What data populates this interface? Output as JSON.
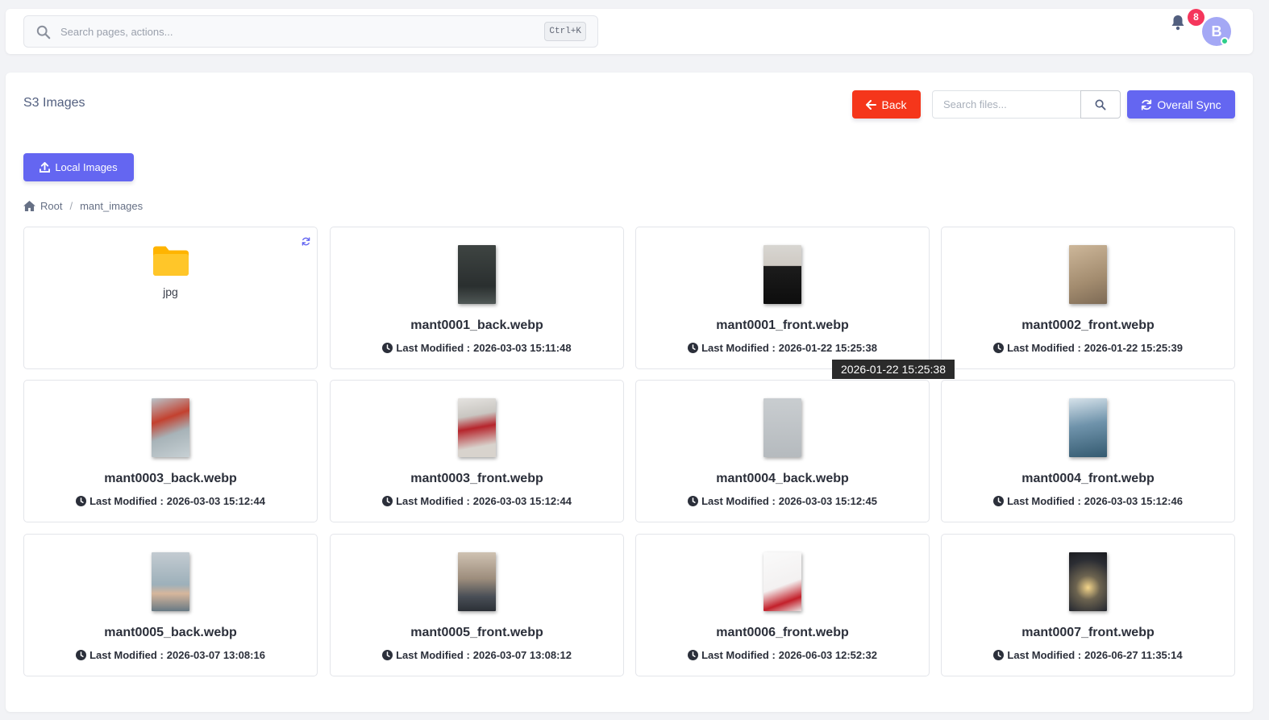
{
  "topbar": {
    "search_placeholder": "Search pages, actions...",
    "shortcut": "Ctrl+K",
    "notification_count": "8",
    "avatar_initial": "B"
  },
  "page": {
    "title": "S3 Images",
    "back_label": "Back",
    "search_files_placeholder": "Search files...",
    "sync_label": "Overall Sync",
    "local_images_label": "Local Images"
  },
  "breadcrumb": {
    "root": "Root",
    "separator": "/",
    "current": "mant_images"
  },
  "folder": {
    "name": "jpg"
  },
  "modified_prefix": "Last Modified : ",
  "files": [
    {
      "name": "mant0001_back.webp",
      "modified": "2026-03-03 15:11:48"
    },
    {
      "name": "mant0001_front.webp",
      "modified": "2026-01-22 15:25:38"
    },
    {
      "name": "mant0002_front.webp",
      "modified": "2026-01-22 15:25:39"
    },
    {
      "name": "mant0003_back.webp",
      "modified": "2026-03-03 15:12:44"
    },
    {
      "name": "mant0003_front.webp",
      "modified": "2026-03-03 15:12:44"
    },
    {
      "name": "mant0004_back.webp",
      "modified": "2026-03-03 15:12:45"
    },
    {
      "name": "mant0004_front.webp",
      "modified": "2026-03-03 15:12:46"
    },
    {
      "name": "mant0005_back.webp",
      "modified": "2026-03-07 13:08:16"
    },
    {
      "name": "mant0005_front.webp",
      "modified": "2026-03-07 13:08:12"
    },
    {
      "name": "mant0006_front.webp",
      "modified": "2026-06-03 12:52:32"
    },
    {
      "name": "mant0007_front.webp",
      "modified": "2026-06-27 11:35:14"
    }
  ],
  "tooltip": "2026-01-22 15:25:38",
  "colors": {
    "primary": "#6466f1",
    "danger": "#f5361b",
    "folder": "#ffb400",
    "online": "#2dce89"
  },
  "icons": [
    "search-icon",
    "bell-icon",
    "arrow-left-icon",
    "sync-icon",
    "upload-icon",
    "home-icon",
    "folder-icon",
    "refresh-icon",
    "clock-icon"
  ]
}
